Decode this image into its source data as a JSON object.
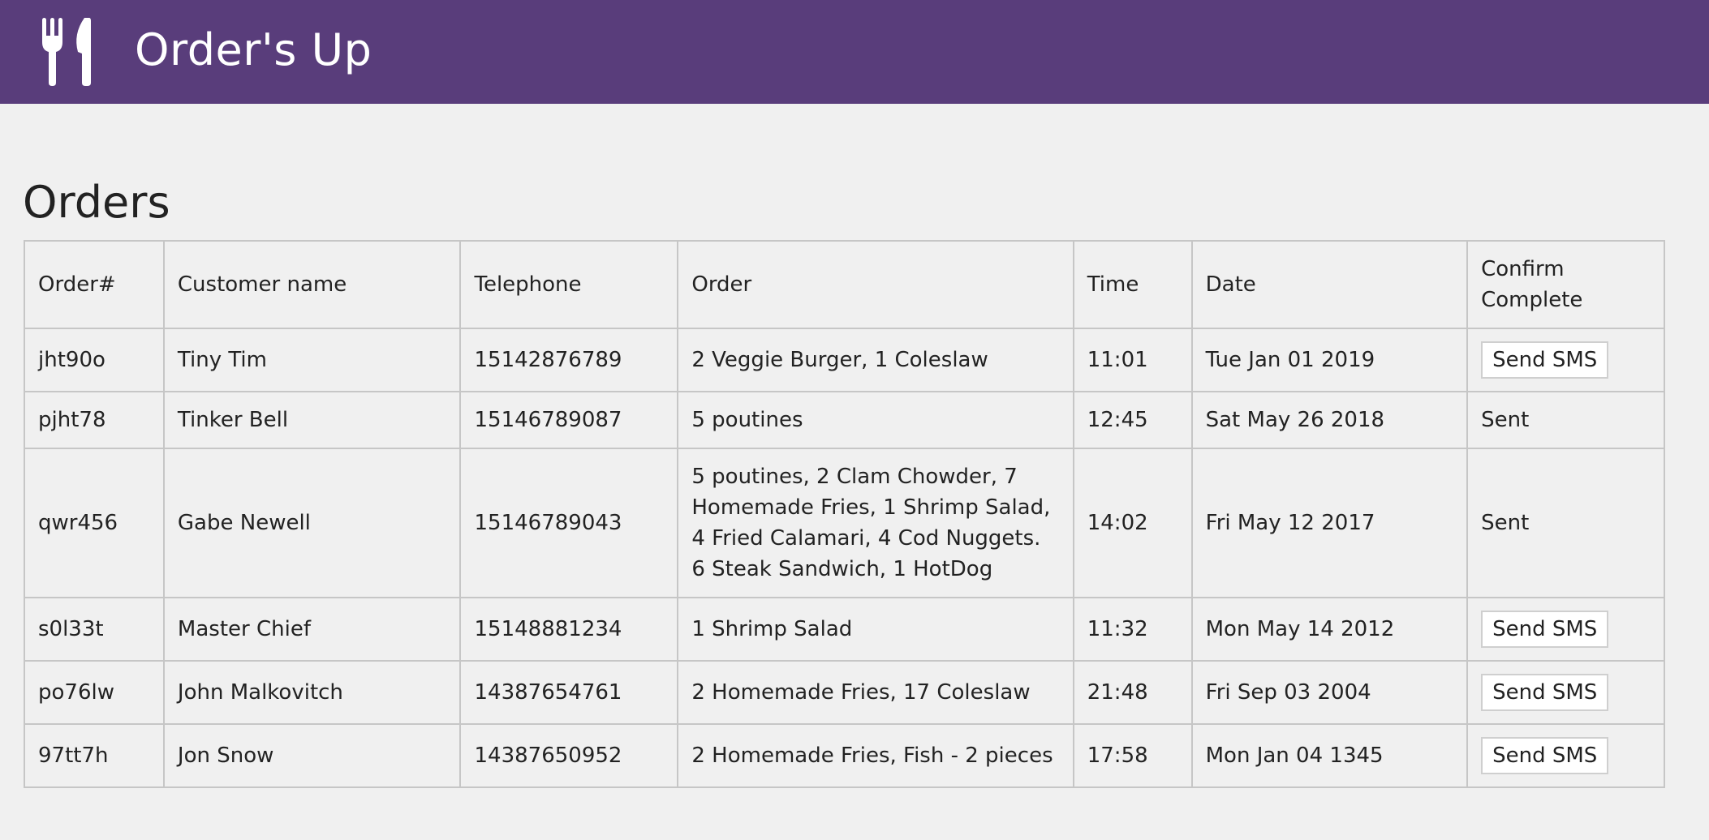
{
  "app": {
    "title": "Order's Up",
    "logo_icon": "utensils-icon",
    "header_color": "#593d7b"
  },
  "page": {
    "title": "Orders"
  },
  "table": {
    "headers": [
      "Order#",
      "Customer name",
      "Telephone",
      "Order",
      "Time",
      "Date",
      "Confirm Complete"
    ],
    "rows": [
      {
        "order_id": "jht90o",
        "customer": "Tiny Tim",
        "telephone": "15142876789",
        "order": "2 Veggie Burger, 1 Coleslaw",
        "time": "11:01",
        "date": "Tue Jan 01 2019",
        "status": "button",
        "action": "Send SMS"
      },
      {
        "order_id": "pjht78",
        "customer": "Tinker Bell",
        "telephone": "15146789087",
        "order": "5 poutines",
        "time": "12:45",
        "date": "Sat May 26 2018",
        "status": "sent",
        "action": "Sent"
      },
      {
        "order_id": "qwr456",
        "customer": "Gabe Newell",
        "telephone": "15146789043",
        "order": "5 poutines, 2 Clam Chowder, 7 Homemade Fries, 1 Shrimp Salad, 4 Fried Calamari, 4 Cod Nuggets. 6 Steak Sandwich, 1 HotDog",
        "time": "14:02",
        "date": "Fri May 12 2017",
        "status": "sent",
        "action": "Sent"
      },
      {
        "order_id": "s0l33t",
        "customer": "Master Chief",
        "telephone": "15148881234",
        "order": "1 Shrimp Salad",
        "time": "11:32",
        "date": "Mon May 14 2012",
        "status": "button",
        "action": "Send SMS"
      },
      {
        "order_id": "po76lw",
        "customer": "John Malkovitch",
        "telephone": "14387654761",
        "order": "2 Homemade Fries, 17 Coleslaw",
        "time": "21:48",
        "date": "Fri Sep 03 2004",
        "status": "button",
        "action": "Send SMS"
      },
      {
        "order_id": "97tt7h",
        "customer": "Jon Snow",
        "telephone": "14387650952",
        "order": "2 Homemade Fries, Fish - 2 pieces",
        "time": "17:58",
        "date": "Mon Jan 04 1345",
        "status": "button",
        "action": "Send SMS"
      }
    ]
  }
}
